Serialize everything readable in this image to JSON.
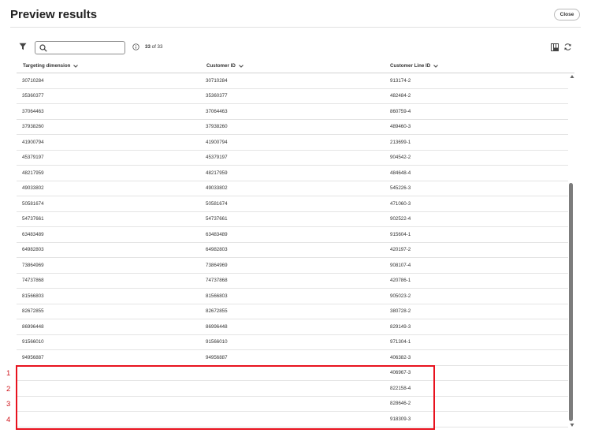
{
  "header": {
    "title": "Preview results",
    "close_label": "Close"
  },
  "toolbar": {
    "search_value": "",
    "search_placeholder": "",
    "count_current": "33",
    "count_rest": "of 33"
  },
  "columns": [
    {
      "label": "Targeting dimension",
      "icon": "chevron-down-icon"
    },
    {
      "label": "Customer ID",
      "icon": "chevron-down-icon"
    },
    {
      "label": "Customer Line ID",
      "icon": "chevron-down-icon"
    }
  ],
  "rows": [
    [
      "30710284",
      "30710284",
      "913174-2"
    ],
    [
      "35360377",
      "35360377",
      "482484-2"
    ],
    [
      "37064463",
      "37064463",
      "860759-4"
    ],
    [
      "37938260",
      "37938260",
      "489460-3"
    ],
    [
      "41900794",
      "41900794",
      "213699-1"
    ],
    [
      "45379197",
      "45379197",
      "904542-2"
    ],
    [
      "48217959",
      "48217959",
      "484648-4"
    ],
    [
      "49033802",
      "49033802",
      "545226-3"
    ],
    [
      "50581674",
      "50581674",
      "471060-3"
    ],
    [
      "54737661",
      "54737661",
      "902522-4"
    ],
    [
      "63483489",
      "63483489",
      "915604-1"
    ],
    [
      "64982803",
      "64982803",
      "420197-2"
    ],
    [
      "73864969",
      "73864969",
      "908107-4"
    ],
    [
      "74737868",
      "74737868",
      "420786-1"
    ],
    [
      "81566803",
      "81566803",
      "905023-2"
    ],
    [
      "82672855",
      "82672855",
      "380728-2"
    ],
    [
      "86996448",
      "86996448",
      "829149-3"
    ],
    [
      "91566010",
      "91566010",
      "971304-1"
    ],
    [
      "94956887",
      "94956887",
      "406382-3"
    ],
    [
      "",
      "",
      "406967-3"
    ],
    [
      "",
      "",
      "822158-4"
    ],
    [
      "",
      "",
      "828646-2"
    ],
    [
      "",
      "",
      "918309-3"
    ]
  ],
  "annotation": {
    "color": "#e8121e",
    "markers": [
      "1",
      "2",
      "3",
      "4"
    ]
  },
  "icons": {
    "filter": "filter-icon",
    "search": "search-icon",
    "info": "info-icon",
    "columns": "columns-icon",
    "refresh": "refresh-icon"
  }
}
